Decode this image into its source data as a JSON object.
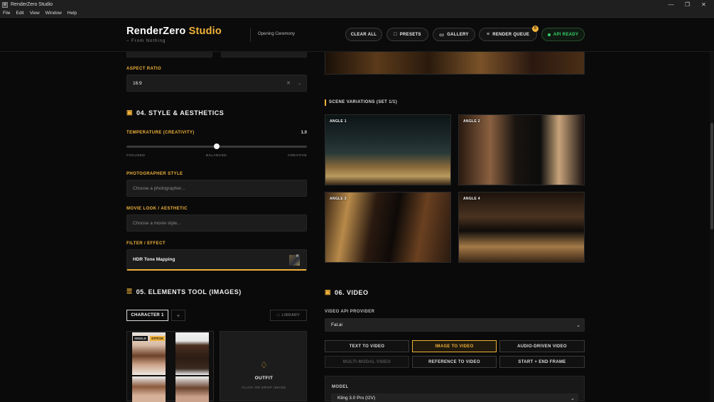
{
  "window": {
    "title": "RenderZero Studio",
    "app_icon_glyph": "R"
  },
  "menu": [
    "File",
    "Edit",
    "View",
    "Window",
    "Help"
  ],
  "header": {
    "logo_main": "RenderZero",
    "logo_accent": "Studio",
    "tagline": "– From Nothing",
    "project": "Opening Ceremony",
    "buttons": {
      "clear_all": "CLEAR ALL",
      "presets": "PRESETS",
      "gallery": "GALLERY",
      "render_queue": "RENDER QUEUE",
      "render_queue_badge": "0",
      "api_ready": "API READY"
    }
  },
  "left": {
    "aspect_ratio": {
      "label": "ASPECT RATIO",
      "value": "16:9"
    },
    "section_04": "04. STYLE & AESTHETICS",
    "temperature": {
      "label": "TEMPERATURE (CREATIVITY)",
      "value": "1.0",
      "min_label": "FOCUSED",
      "mid_label": "BALANCED",
      "max_label": "CREATIVE",
      "fraction": 0.5
    },
    "photographer": {
      "label": "PHOTOGRAPHER STYLE",
      "placeholder": "Choose a photographer..."
    },
    "movie_look": {
      "label": "MOVIE LOOK / AESTHETIC",
      "placeholder": "Choose a movie style..."
    },
    "filter": {
      "label": "FILTER / EFFECT",
      "value": "HDR Tone Mapping"
    },
    "section_05": "05. ELEMENTS TOOL (IMAGES)",
    "character_tab": "CHARACTER 1",
    "add_tab": "+",
    "library": "LIBRARY",
    "tag_single": "SINGLE",
    "tag_stitch": "STITCH",
    "outfit": {
      "title": "OUTFIT",
      "hint": "CLICK OR DROP IMAGE"
    }
  },
  "right": {
    "scene_variations": "SCENE VARIATIONS (SET 1/1)",
    "angles": [
      "ANGLE 1",
      "ANGLE 2",
      "ANGLE 3",
      "ANGLE 4"
    ],
    "section_06": "06. VIDEO",
    "video_provider": {
      "label": "VIDEO API PROVIDER",
      "value": "Fal.ai"
    },
    "video_modes": [
      "TEXT TO VIDEO",
      "IMAGE TO VIDEO",
      "AUDIO-DRIVEN VIDEO",
      "MULTI-MODAL VIDEO",
      "REFERENCE TO VIDEO",
      "START + END FRAME"
    ],
    "model": {
      "label": "MODEL",
      "value": "Kling 3.0 Pro (I2V)"
    }
  },
  "colors": {
    "accent": "#f0b23a",
    "ready": "#39d26b",
    "panel": "#1c1c1c"
  }
}
